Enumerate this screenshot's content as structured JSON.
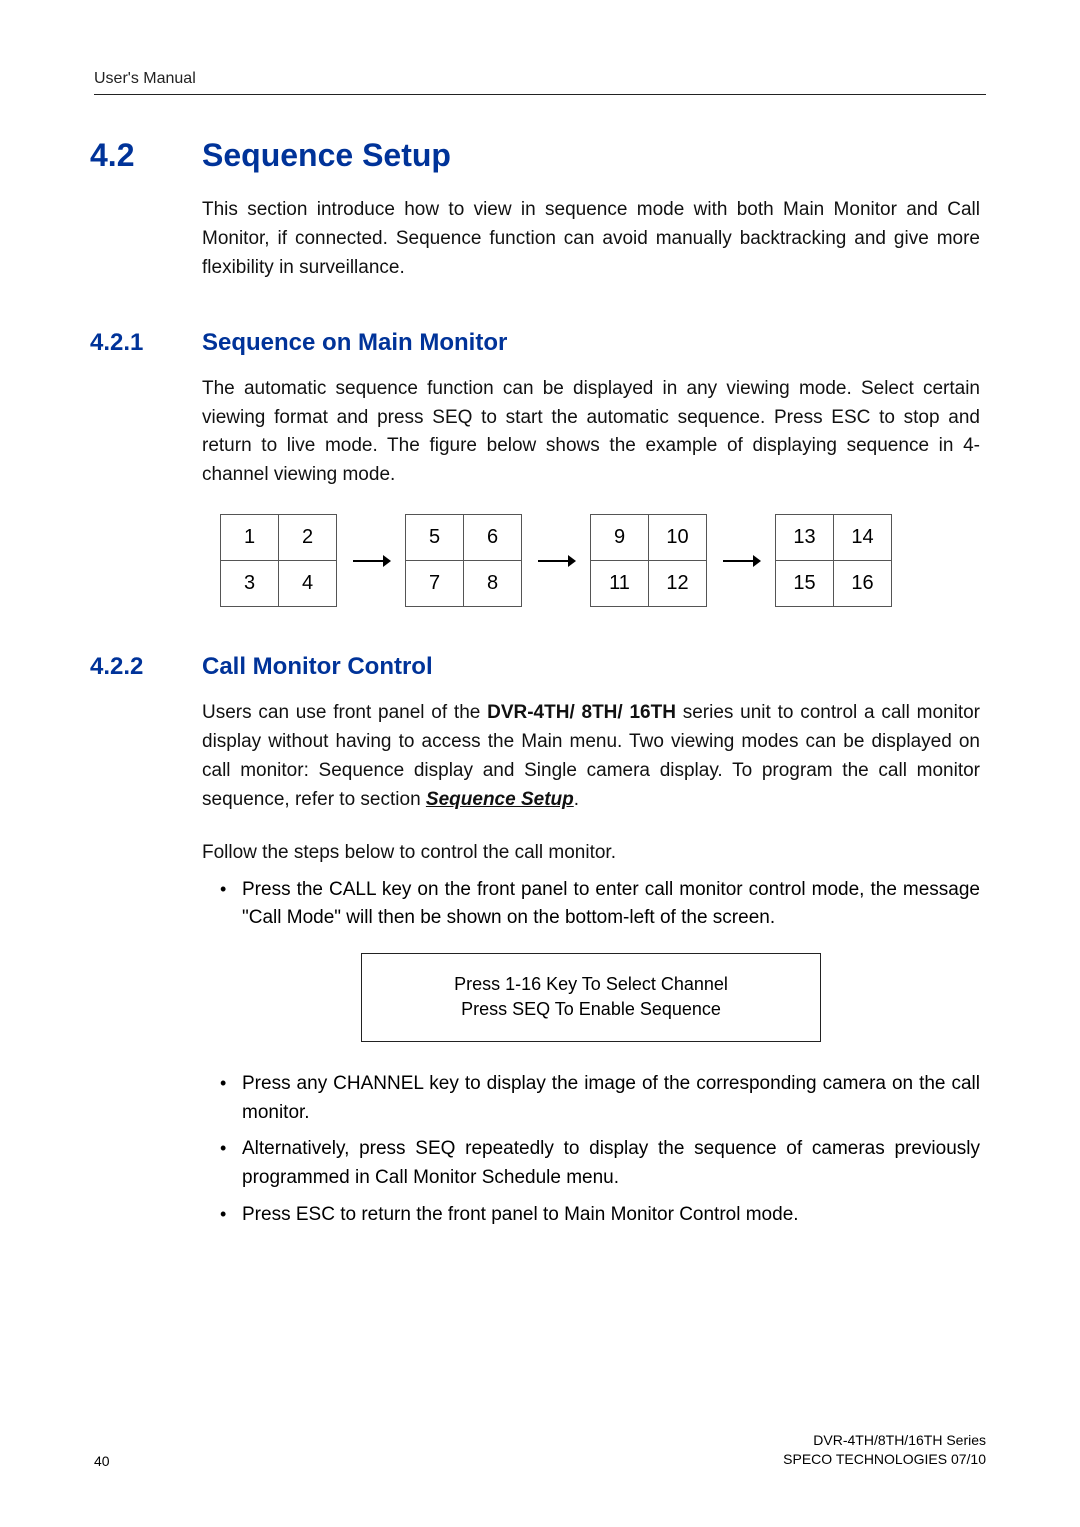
{
  "header": {
    "running": "User's Manual"
  },
  "h2": {
    "num": "4.2",
    "title": "Sequence Setup"
  },
  "intro": "This section introduce how to view in sequence mode with both Main Monitor and Call Monitor, if connected. Sequence function can avoid manually backtracking and give more flexibility in surveillance.",
  "s421": {
    "num": "4.2.1",
    "title": "Sequence on Main Monitor",
    "para": "The automatic sequence function can be displayed in any viewing mode. Select certain viewing format and press SEQ to start the automatic sequence. Press ESC to stop and return to live mode. The figure below shows the example of displaying sequence in 4-channel viewing mode."
  },
  "grids": [
    [
      [
        "1",
        "2"
      ],
      [
        "3",
        "4"
      ]
    ],
    [
      [
        "5",
        "6"
      ],
      [
        "7",
        "8"
      ]
    ],
    [
      [
        "9",
        "10"
      ],
      [
        "11",
        "12"
      ]
    ],
    [
      [
        "13",
        "14"
      ],
      [
        "15",
        "16"
      ]
    ]
  ],
  "s422": {
    "num": "4.2.2",
    "title": "Call Monitor Control",
    "para_pre": "Users can use front panel of the ",
    "model": "DVR-4TH/ 8TH/ 16TH",
    "para_mid": " series unit to control a call monitor display without having to access the Main menu. Two viewing modes can be displayed on call monitor: Sequence display and Single camera display. To program the call monitor sequence, refer to section ",
    "ref": "Sequence Setup",
    "para_post": ".",
    "follow": "Follow the steps below to control the call monitor.",
    "b1": "Press the CALL key on the front panel to enter call monitor control mode, the message \"Call Mode\" will then be shown on the bottom-left of the screen.",
    "msg1": "Press 1-16 Key To Select Channel",
    "msg2": "Press SEQ To Enable Sequence",
    "b2": "Press any CHANNEL key to display the image of the corresponding camera on the call monitor.",
    "b3": "Alternatively, press SEQ repeatedly to display the sequence of cameras previously programmed in Call Monitor Schedule menu.",
    "b4": "Press ESC to return the front panel to Main Monitor Control mode."
  },
  "footer": {
    "page": "40",
    "line1": "DVR-4TH/8TH/16TH Series",
    "line2": "SPECO TECHNOLOGIES 07/10"
  }
}
